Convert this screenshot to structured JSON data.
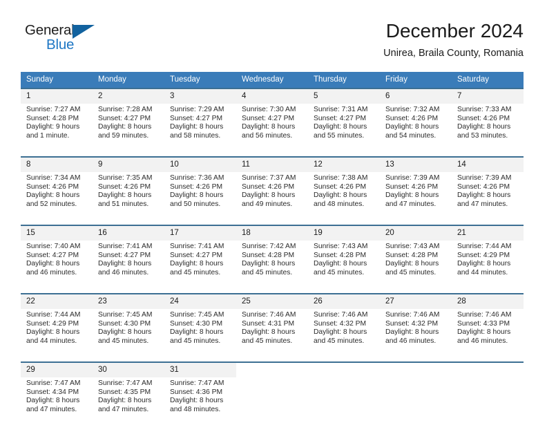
{
  "brand": {
    "name_part1": "General",
    "name_part2": "Blue",
    "accent_color": "#1f77c4",
    "triangle_color": "#12629f"
  },
  "header": {
    "title": "December 2024",
    "subtitle": "Unirea, Braila County, Romania"
  },
  "calendar": {
    "header_bg": "#3a7cb9",
    "daynum_bg": "#f2f2f2",
    "separator_color": "#3c6f93",
    "weekdays": [
      "Sunday",
      "Monday",
      "Tuesday",
      "Wednesday",
      "Thursday",
      "Friday",
      "Saturday"
    ],
    "weeks": [
      {
        "days": [
          {
            "num": "1",
            "sunrise": "Sunrise: 7:27 AM",
            "sunset": "Sunset: 4:28 PM",
            "daylight_line1": "Daylight: 9 hours",
            "daylight_line2": "and 1 minute."
          },
          {
            "num": "2",
            "sunrise": "Sunrise: 7:28 AM",
            "sunset": "Sunset: 4:27 PM",
            "daylight_line1": "Daylight: 8 hours",
            "daylight_line2": "and 59 minutes."
          },
          {
            "num": "3",
            "sunrise": "Sunrise: 7:29 AM",
            "sunset": "Sunset: 4:27 PM",
            "daylight_line1": "Daylight: 8 hours",
            "daylight_line2": "and 58 minutes."
          },
          {
            "num": "4",
            "sunrise": "Sunrise: 7:30 AM",
            "sunset": "Sunset: 4:27 PM",
            "daylight_line1": "Daylight: 8 hours",
            "daylight_line2": "and 56 minutes."
          },
          {
            "num": "5",
            "sunrise": "Sunrise: 7:31 AM",
            "sunset": "Sunset: 4:27 PM",
            "daylight_line1": "Daylight: 8 hours",
            "daylight_line2": "and 55 minutes."
          },
          {
            "num": "6",
            "sunrise": "Sunrise: 7:32 AM",
            "sunset": "Sunset: 4:26 PM",
            "daylight_line1": "Daylight: 8 hours",
            "daylight_line2": "and 54 minutes."
          },
          {
            "num": "7",
            "sunrise": "Sunrise: 7:33 AM",
            "sunset": "Sunset: 4:26 PM",
            "daylight_line1": "Daylight: 8 hours",
            "daylight_line2": "and 53 minutes."
          }
        ]
      },
      {
        "days": [
          {
            "num": "8",
            "sunrise": "Sunrise: 7:34 AM",
            "sunset": "Sunset: 4:26 PM",
            "daylight_line1": "Daylight: 8 hours",
            "daylight_line2": "and 52 minutes."
          },
          {
            "num": "9",
            "sunrise": "Sunrise: 7:35 AM",
            "sunset": "Sunset: 4:26 PM",
            "daylight_line1": "Daylight: 8 hours",
            "daylight_line2": "and 51 minutes."
          },
          {
            "num": "10",
            "sunrise": "Sunrise: 7:36 AM",
            "sunset": "Sunset: 4:26 PM",
            "daylight_line1": "Daylight: 8 hours",
            "daylight_line2": "and 50 minutes."
          },
          {
            "num": "11",
            "sunrise": "Sunrise: 7:37 AM",
            "sunset": "Sunset: 4:26 PM",
            "daylight_line1": "Daylight: 8 hours",
            "daylight_line2": "and 49 minutes."
          },
          {
            "num": "12",
            "sunrise": "Sunrise: 7:38 AM",
            "sunset": "Sunset: 4:26 PM",
            "daylight_line1": "Daylight: 8 hours",
            "daylight_line2": "and 48 minutes."
          },
          {
            "num": "13",
            "sunrise": "Sunrise: 7:39 AM",
            "sunset": "Sunset: 4:26 PM",
            "daylight_line1": "Daylight: 8 hours",
            "daylight_line2": "and 47 minutes."
          },
          {
            "num": "14",
            "sunrise": "Sunrise: 7:39 AM",
            "sunset": "Sunset: 4:26 PM",
            "daylight_line1": "Daylight: 8 hours",
            "daylight_line2": "and 47 minutes."
          }
        ]
      },
      {
        "days": [
          {
            "num": "15",
            "sunrise": "Sunrise: 7:40 AM",
            "sunset": "Sunset: 4:27 PM",
            "daylight_line1": "Daylight: 8 hours",
            "daylight_line2": "and 46 minutes."
          },
          {
            "num": "16",
            "sunrise": "Sunrise: 7:41 AM",
            "sunset": "Sunset: 4:27 PM",
            "daylight_line1": "Daylight: 8 hours",
            "daylight_line2": "and 46 minutes."
          },
          {
            "num": "17",
            "sunrise": "Sunrise: 7:41 AM",
            "sunset": "Sunset: 4:27 PM",
            "daylight_line1": "Daylight: 8 hours",
            "daylight_line2": "and 45 minutes."
          },
          {
            "num": "18",
            "sunrise": "Sunrise: 7:42 AM",
            "sunset": "Sunset: 4:28 PM",
            "daylight_line1": "Daylight: 8 hours",
            "daylight_line2": "and 45 minutes."
          },
          {
            "num": "19",
            "sunrise": "Sunrise: 7:43 AM",
            "sunset": "Sunset: 4:28 PM",
            "daylight_line1": "Daylight: 8 hours",
            "daylight_line2": "and 45 minutes."
          },
          {
            "num": "20",
            "sunrise": "Sunrise: 7:43 AM",
            "sunset": "Sunset: 4:28 PM",
            "daylight_line1": "Daylight: 8 hours",
            "daylight_line2": "and 45 minutes."
          },
          {
            "num": "21",
            "sunrise": "Sunrise: 7:44 AM",
            "sunset": "Sunset: 4:29 PM",
            "daylight_line1": "Daylight: 8 hours",
            "daylight_line2": "and 44 minutes."
          }
        ]
      },
      {
        "days": [
          {
            "num": "22",
            "sunrise": "Sunrise: 7:44 AM",
            "sunset": "Sunset: 4:29 PM",
            "daylight_line1": "Daylight: 8 hours",
            "daylight_line2": "and 44 minutes."
          },
          {
            "num": "23",
            "sunrise": "Sunrise: 7:45 AM",
            "sunset": "Sunset: 4:30 PM",
            "daylight_line1": "Daylight: 8 hours",
            "daylight_line2": "and 45 minutes."
          },
          {
            "num": "24",
            "sunrise": "Sunrise: 7:45 AM",
            "sunset": "Sunset: 4:30 PM",
            "daylight_line1": "Daylight: 8 hours",
            "daylight_line2": "and 45 minutes."
          },
          {
            "num": "25",
            "sunrise": "Sunrise: 7:46 AM",
            "sunset": "Sunset: 4:31 PM",
            "daylight_line1": "Daylight: 8 hours",
            "daylight_line2": "and 45 minutes."
          },
          {
            "num": "26",
            "sunrise": "Sunrise: 7:46 AM",
            "sunset": "Sunset: 4:32 PM",
            "daylight_line1": "Daylight: 8 hours",
            "daylight_line2": "and 45 minutes."
          },
          {
            "num": "27",
            "sunrise": "Sunrise: 7:46 AM",
            "sunset": "Sunset: 4:32 PM",
            "daylight_line1": "Daylight: 8 hours",
            "daylight_line2": "and 46 minutes."
          },
          {
            "num": "28",
            "sunrise": "Sunrise: 7:46 AM",
            "sunset": "Sunset: 4:33 PM",
            "daylight_line1": "Daylight: 8 hours",
            "daylight_line2": "and 46 minutes."
          }
        ]
      },
      {
        "days": [
          {
            "num": "29",
            "sunrise": "Sunrise: 7:47 AM",
            "sunset": "Sunset: 4:34 PM",
            "daylight_line1": "Daylight: 8 hours",
            "daylight_line2": "and 47 minutes."
          },
          {
            "num": "30",
            "sunrise": "Sunrise: 7:47 AM",
            "sunset": "Sunset: 4:35 PM",
            "daylight_line1": "Daylight: 8 hours",
            "daylight_line2": "and 47 minutes."
          },
          {
            "num": "31",
            "sunrise": "Sunrise: 7:47 AM",
            "sunset": "Sunset: 4:36 PM",
            "daylight_line1": "Daylight: 8 hours",
            "daylight_line2": "and 48 minutes."
          },
          {
            "num": "",
            "sunrise": "",
            "sunset": "",
            "daylight_line1": "",
            "daylight_line2": ""
          },
          {
            "num": "",
            "sunrise": "",
            "sunset": "",
            "daylight_line1": "",
            "daylight_line2": ""
          },
          {
            "num": "",
            "sunrise": "",
            "sunset": "",
            "daylight_line1": "",
            "daylight_line2": ""
          },
          {
            "num": "",
            "sunrise": "",
            "sunset": "",
            "daylight_line1": "",
            "daylight_line2": ""
          }
        ]
      }
    ]
  }
}
